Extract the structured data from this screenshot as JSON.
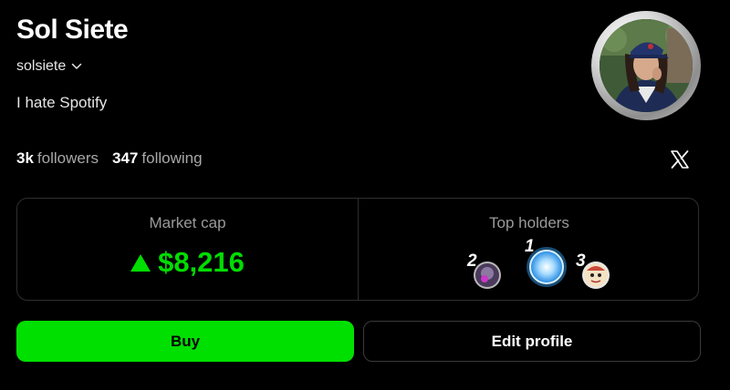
{
  "profile": {
    "display_name": "Sol Siete",
    "handle": "solsiete",
    "bio": "I hate Spotify",
    "followers_count": "3k",
    "followers_label": "followers",
    "following_count": "347",
    "following_label": "following"
  },
  "stats": {
    "market_cap_label": "Market cap",
    "market_cap_value": "$8,216",
    "top_holders_label": "Top holders",
    "holder_ranks": [
      "2",
      "1",
      "3"
    ]
  },
  "actions": {
    "buy_label": "Buy",
    "edit_label": "Edit profile"
  },
  "colors": {
    "accent_green": "#00e000",
    "background": "#000000",
    "border": "#2f2f2f"
  },
  "icons": {
    "handle_dropdown": "chevron-down-icon",
    "social": "x-logo-icon",
    "market_trend": "triangle-up-icon"
  }
}
